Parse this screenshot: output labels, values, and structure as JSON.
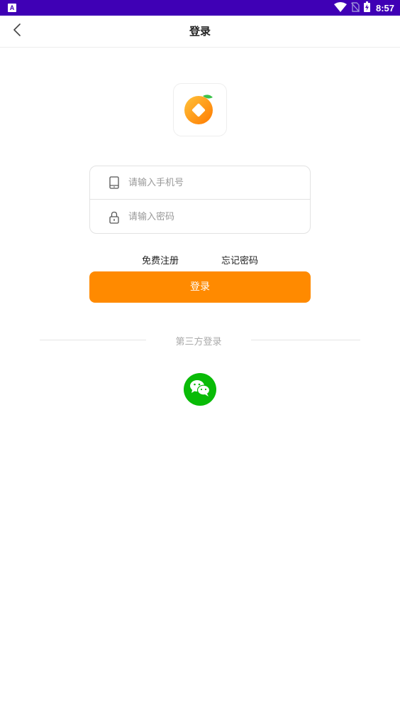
{
  "status_bar": {
    "time": "8:57",
    "notification_glyph": "A",
    "background": "#3f00b5",
    "icons": [
      "wifi-icon",
      "no-sim-icon",
      "battery-charging-icon"
    ]
  },
  "nav": {
    "title": "登录",
    "back_icon": "chevron-left-icon"
  },
  "logo": {
    "icon": "orange-app-logo",
    "accent_color": "#ff8a00"
  },
  "form": {
    "phone": {
      "placeholder": "请输入手机号",
      "value": "",
      "icon": "phone-icon"
    },
    "password": {
      "placeholder": "请输入密码",
      "value": "",
      "icon": "lock-icon"
    }
  },
  "links": {
    "register": "免费注册",
    "forgot": "忘记密码"
  },
  "login_button": {
    "label": "登录",
    "color": "#ff8a00"
  },
  "third_party": {
    "label": "第三方登录",
    "providers": [
      {
        "icon": "wechat-icon",
        "color": "#09bb07"
      }
    ]
  }
}
